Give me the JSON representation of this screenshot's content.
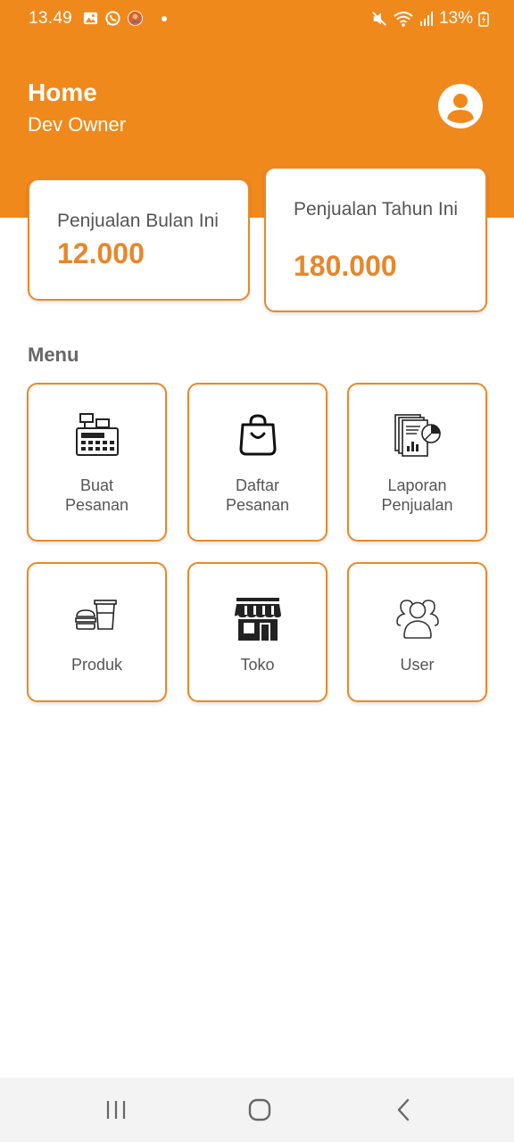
{
  "status_bar": {
    "time": "13.49",
    "battery": "13%",
    "icons": [
      "gallery-icon",
      "whatsapp-icon",
      "app-notification-icon",
      "mute-icon",
      "wifi-icon",
      "signal-icon",
      "battery-charging-icon"
    ]
  },
  "header": {
    "title": "Home",
    "subtitle": "Dev Owner",
    "profile_icon": "account-circle-icon"
  },
  "stats": [
    {
      "label": "Penjualan Bulan Ini",
      "value": "12.000"
    },
    {
      "label": "Penjualan Tahun Ini",
      "value": "180.000"
    }
  ],
  "menu": {
    "heading": "Menu",
    "items": [
      {
        "label": "Buat\nPesanan",
        "icon": "cash-register-icon"
      },
      {
        "label": "Daftar\nPesanan",
        "icon": "shopping-bag-icon"
      },
      {
        "label": "Laporan\nPenjualan",
        "icon": "sales-report-icon"
      },
      {
        "label": "Produk",
        "icon": "food-products-icon"
      },
      {
        "label": "Toko",
        "icon": "store-icon"
      },
      {
        "label": "User",
        "icon": "users-icon"
      }
    ]
  },
  "nav_bar": {
    "buttons": [
      "recent-apps-icon",
      "home-icon",
      "back-icon"
    ]
  },
  "colors": {
    "accent": "#F0891C",
    "accent_text": "#E8862A",
    "nav_bg": "#F3F3F3"
  }
}
